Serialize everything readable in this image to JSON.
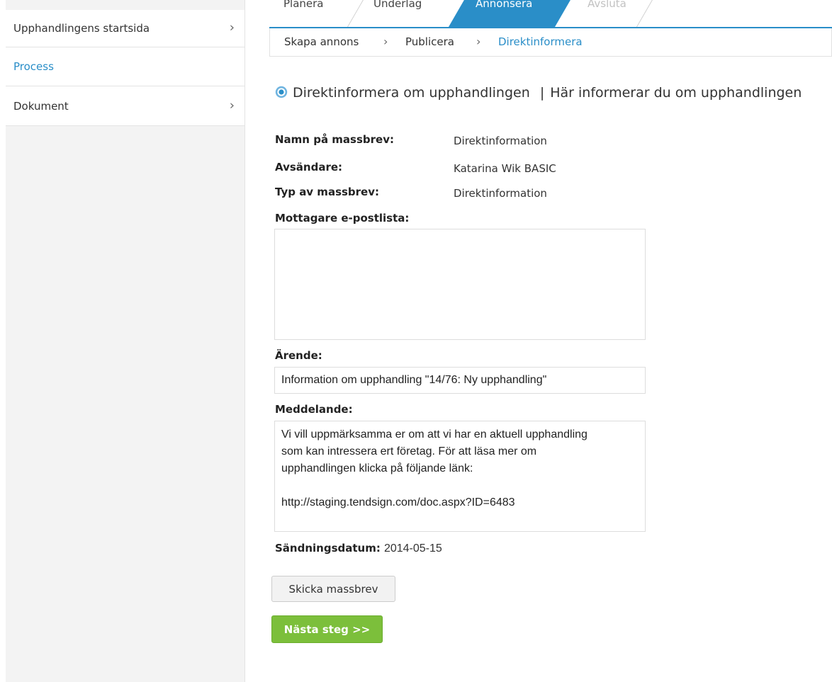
{
  "sidebar": {
    "items": [
      {
        "label": "Upphandlingens startsida",
        "has_chevron": true
      },
      {
        "label": "Process",
        "active": true
      },
      {
        "label": "Dokument",
        "has_chevron": true
      }
    ]
  },
  "process_tabs": [
    {
      "label": "Planera"
    },
    {
      "label": "Underlag"
    },
    {
      "label": "Annonsera",
      "state": "active"
    },
    {
      "label": "Avsluta",
      "state": "disabled"
    }
  ],
  "breadcrumb": [
    "Skapa annons",
    "Publicera",
    "Direktinformera"
  ],
  "page": {
    "title": "Direktinformera om upphandlingen",
    "separator": "|",
    "subtitle": "Här informerar du om upphandlingen"
  },
  "form": {
    "name_label": "Namn på massbrev:",
    "name_value": "Direktinformation",
    "sender_label": "Avsändare:",
    "sender_value": "Katarina Wik BASIC",
    "type_label": "Typ av massbrev:",
    "type_value": "Direktinformation",
    "recipients_label": "Mottagare e-postlista:",
    "recipients_value": "",
    "subject_label": "Ärende:",
    "subject_value": "Information om upphandling \"14/76: Ny upphandling\"",
    "message_label": "Meddelande:",
    "message_lines": [
      "Vi vill uppmärksamma er om att vi har en aktuell upphandling",
      "som kan intressera ert företag. För att läsa mer om",
      "upphandlingen klicka på följande länk:",
      "",
      "http://staging.tendsign.com/doc.aspx?ID=6483"
    ],
    "send_date_label": "Sändningsdatum:",
    "send_date_value": "2014-05-15"
  },
  "buttons": {
    "send": "Skicka massbrev",
    "next": "Nästa steg >>"
  },
  "colors": {
    "accent": "#2a8ec8",
    "next_button": "#7cbf3b"
  }
}
